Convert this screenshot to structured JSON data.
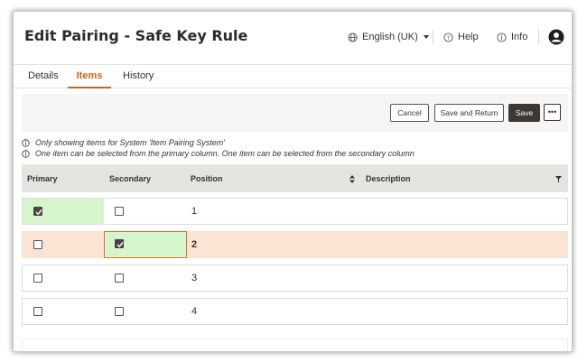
{
  "header": {
    "title": "Edit Pairing - Safe Key Rule",
    "language": "English (UK)",
    "help_label": "Help",
    "info_label": "Info",
    "icons": {
      "language": "globe-icon",
      "help": "question-circle-icon",
      "info": "info-circle-icon",
      "user": "user-avatar-icon"
    }
  },
  "tabs": [
    {
      "label": "Details",
      "active": false
    },
    {
      "label": "Items",
      "active": true
    },
    {
      "label": "History",
      "active": false
    }
  ],
  "toolbar": {
    "cancel_label": "Cancel",
    "save_return_label": "Save and Return",
    "save_label": "Save",
    "more_label": "•••"
  },
  "notes": [
    "Only showing items for System 'Item Pairing System'",
    "One item can be selected from the primary column. One item can be selected from the secondary column"
  ],
  "table": {
    "columns": [
      "Primary",
      "Secondary",
      "Position",
      "Description"
    ],
    "rows": [
      {
        "primary": true,
        "secondary": false,
        "position": "1",
        "description": ""
      },
      {
        "primary": false,
        "secondary": true,
        "position": "2",
        "description": ""
      },
      {
        "primary": false,
        "secondary": false,
        "position": "3",
        "description": ""
      },
      {
        "primary": false,
        "secondary": false,
        "position": "4",
        "description": ""
      }
    ]
  },
  "colors": {
    "accent": "#c8661e",
    "selected_row": "#fbe4d3",
    "checked_cell": "#d6f5cc",
    "primary_button": "#3b3835",
    "header_row": "#e6e4e1"
  }
}
